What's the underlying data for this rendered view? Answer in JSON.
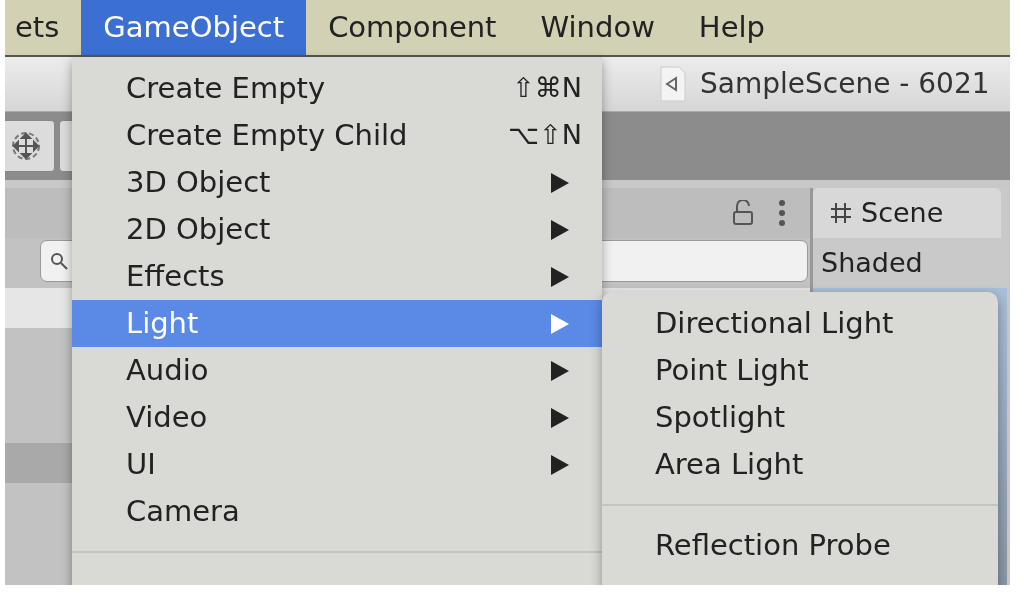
{
  "menubar": [
    {
      "label": "ets",
      "selected": false
    },
    {
      "label": "GameObject",
      "selected": true
    },
    {
      "label": "Component",
      "selected": false
    },
    {
      "label": "Window",
      "selected": false
    },
    {
      "label": "Help",
      "selected": false
    }
  ],
  "title": "SampleScene - 6021",
  "scene_tab": {
    "label": "Scene"
  },
  "scene_toolbar": {
    "shading_mode": "Shaded"
  },
  "menu": {
    "items": [
      {
        "kind": "item",
        "label": "Create Empty",
        "shortcut": "⇧⌘N",
        "has_submenu": false,
        "selected": false
      },
      {
        "kind": "item",
        "label": "Create Empty Child",
        "shortcut": "⌥⇧N",
        "has_submenu": false,
        "selected": false
      },
      {
        "kind": "item",
        "label": "3D Object",
        "has_submenu": true,
        "selected": false
      },
      {
        "kind": "item",
        "label": "2D Object",
        "has_submenu": true,
        "selected": false
      },
      {
        "kind": "item",
        "label": "Effects",
        "has_submenu": true,
        "selected": false
      },
      {
        "kind": "item",
        "label": "Light",
        "has_submenu": true,
        "selected": true
      },
      {
        "kind": "item",
        "label": "Audio",
        "has_submenu": true,
        "selected": false
      },
      {
        "kind": "item",
        "label": "Video",
        "has_submenu": true,
        "selected": false
      },
      {
        "kind": "item",
        "label": "UI",
        "has_submenu": true,
        "selected": false
      },
      {
        "kind": "item",
        "label": "Camera",
        "has_submenu": false,
        "selected": false
      },
      {
        "kind": "separator"
      }
    ]
  },
  "submenu": {
    "items": [
      {
        "kind": "item",
        "label": "Directional Light"
      },
      {
        "kind": "item",
        "label": "Point Light"
      },
      {
        "kind": "item",
        "label": "Spotlight"
      },
      {
        "kind": "item",
        "label": "Area Light"
      },
      {
        "kind": "separator"
      },
      {
        "kind": "item",
        "label": "Reflection Probe"
      }
    ]
  }
}
